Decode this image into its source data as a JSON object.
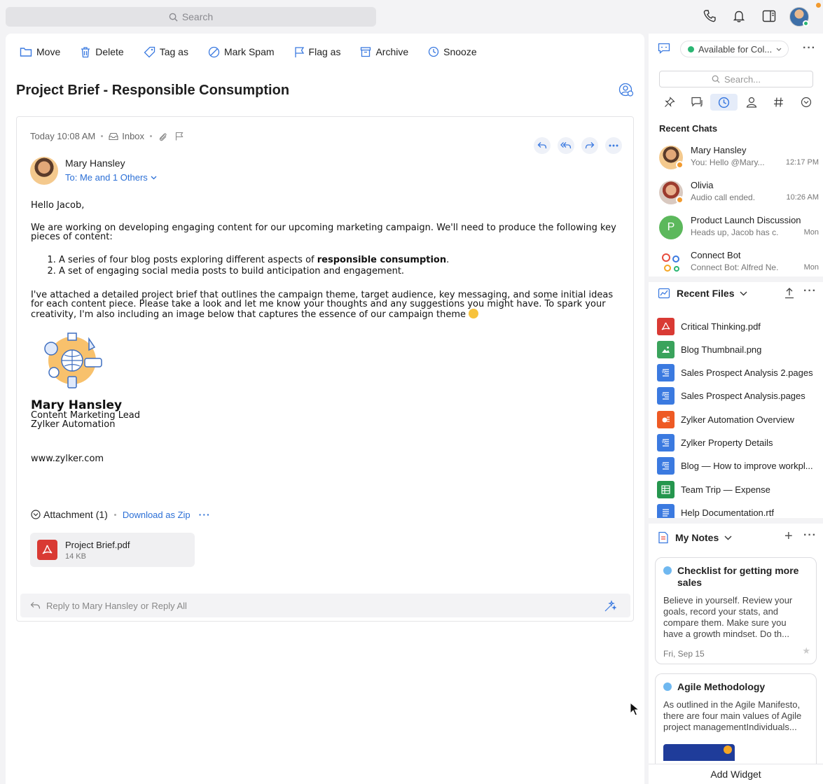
{
  "topbar": {
    "search_placeholder": "Search"
  },
  "toolbar": {
    "move": "Move",
    "delete": "Delete",
    "tag_as": "Tag as",
    "mark_spam": "Mark Spam",
    "flag_as": "Flag as",
    "archive": "Archive",
    "snooze": "Snooze"
  },
  "email": {
    "subject": "Project Brief - Responsible Consumption",
    "time": "Today 10:08 AM",
    "folder": "Inbox",
    "sender": "Mary Hansley",
    "to": "To: Me and 1 Others",
    "greeting": "Hello Jacob,",
    "para1": "We are working on developing engaging content for our upcoming marketing campaign. We'll need to produce the following key pieces of content:",
    "list_item1_pre": "A series of four blog posts exploring different aspects of ",
    "list_item1_bold": "responsible consumption",
    "list_item1_post": ".",
    "list_item2": "A set of engaging social media posts to build anticipation and engagement.",
    "para2": "I've attached a detailed project brief that outlines the campaign theme, target audience, key messaging, and some initial ideas for each content piece. Please take a look and let me know your thoughts and any suggestions you might have. To spark your creativity, I'm also including an image below that captures the essence of our campaign theme ",
    "signature": {
      "name": "Mary Hansley",
      "role": "Content Marketing Lead",
      "company": "Zylker Automation",
      "website": "www.zylker.com"
    },
    "attachments": {
      "title": "Attachment (1)",
      "download": "Download as Zip",
      "file_name": "Project Brief.pdf",
      "file_size": "14 KB"
    },
    "reply": {
      "reply_to": "Reply to Mary Hansley",
      "or": "or",
      "reply_all": "Reply All"
    }
  },
  "sidebar": {
    "status": "Available for Col...",
    "search_placeholder": "Search...",
    "recent_chats_title": "Recent Chats",
    "chats": [
      {
        "name": "Mary Hansley",
        "preview": "You: Hello @Mary...",
        "time": "12:17 PM"
      },
      {
        "name": "Olivia",
        "preview": "Audio call ended.",
        "time": "10:26 AM"
      },
      {
        "name": "Product Launch Discussion",
        "preview": "Heads up, Jacob has c...",
        "time": "Mon",
        "initial": "P"
      },
      {
        "name": "Connect Bot",
        "preview": "Connect Bot: Alfred Ne...",
        "time": "Mon"
      }
    ],
    "files_title": "Recent Files",
    "files": [
      {
        "name": "Critical Thinking.pdf",
        "kind": "pdf",
        "color": "#d93a34"
      },
      {
        "name": "Blog Thumbnail.png",
        "kind": "image",
        "color": "#3aa35c"
      },
      {
        "name": "Sales Prospect Analysis 2.pages",
        "kind": "writer",
        "color": "#3b7ae0"
      },
      {
        "name": "Sales Prospect Analysis.pages",
        "kind": "writer",
        "color": "#3b7ae0"
      },
      {
        "name": "Zylker Automation Overview",
        "kind": "show",
        "color": "#ee5a24"
      },
      {
        "name": "Zylker Property Details",
        "kind": "writer",
        "color": "#3b7ae0"
      },
      {
        "name": "Blog — How to improve workpl...",
        "kind": "writer",
        "color": "#3b7ae0"
      },
      {
        "name": "Team Trip — Expense",
        "kind": "sheet",
        "color": "#25964e"
      },
      {
        "name": "Help Documentation.rtf",
        "kind": "doc",
        "color": "#3b7ae0"
      }
    ],
    "notes_title": "My Notes",
    "notes": [
      {
        "title": "Checklist for getting more sales",
        "body": "Believe in yourself. Review your goals, record your stats, and compare them. Make sure you have a growth mindset. Do th...",
        "date": "Fri, Sep 15"
      },
      {
        "title": "Agile Methodology",
        "body": "As outlined in the Agile Manifesto, there are four main values of Agile project managementIndividuals..."
      }
    ],
    "add_widget": "Add Widget"
  }
}
